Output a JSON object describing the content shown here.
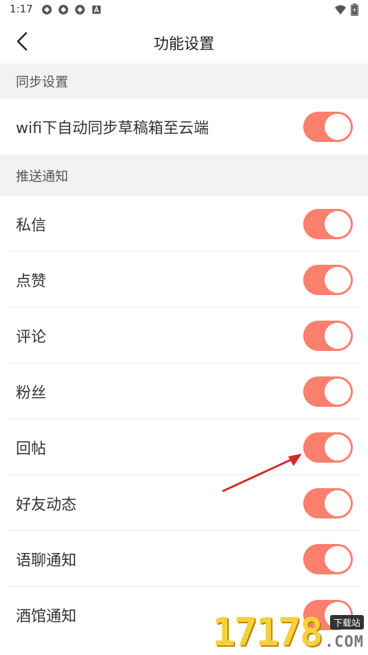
{
  "status_bar": {
    "time": "1:17",
    "left_icons": [
      "app-notification-icon",
      "app-notification-icon",
      "app-notification-icon",
      "a-badge-icon"
    ],
    "right_icons": [
      "wifi-icon",
      "battery-charging-icon"
    ]
  },
  "header": {
    "title": "功能设置",
    "back_icon": "chevron-left-icon"
  },
  "sections": {
    "sync": {
      "title": "同步设置",
      "rows": [
        {
          "label": "wifi下自动同步草稿箱至云端",
          "enabled": true
        }
      ]
    },
    "push": {
      "title": "推送通知",
      "rows": [
        {
          "label": "私信",
          "enabled": true
        },
        {
          "label": "点赞",
          "enabled": true
        },
        {
          "label": "评论",
          "enabled": true
        },
        {
          "label": "粉丝",
          "enabled": true
        },
        {
          "label": "回帖",
          "enabled": true
        },
        {
          "label": "好友动态",
          "enabled": true
        },
        {
          "label": "语聊通知",
          "enabled": true
        },
        {
          "label": "酒馆通知",
          "enabled": true
        }
      ]
    }
  },
  "colors": {
    "toggle_on": "#fa7f6d",
    "section_background": "#f1f2f4",
    "annotation_arrow": "#d62828"
  },
  "watermark": {
    "digits": "17178",
    "badge": "下载站",
    "domain": ".COM"
  }
}
